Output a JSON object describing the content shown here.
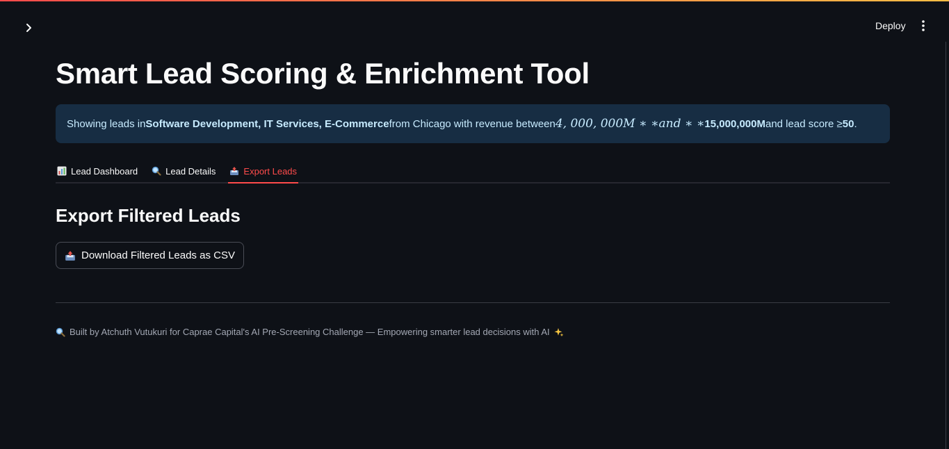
{
  "header": {
    "deploy_label": "Deploy",
    "sidebar_toggle_icon": "chevron-right-icon",
    "menu_icon": "kebab-menu-icon"
  },
  "main": {
    "title": "Smart Lead Scoring & Enrichment Tool",
    "info": {
      "prefix": "Showing leads in ",
      "industries": "Software Development, IT Services, E-Commerce",
      "from_text": " from Chicago with revenue between ",
      "math_text": "4, 000, 000M ∗ ∗and ∗ ∗",
      "max_revenue": "15,000,000M",
      "score_text": " and lead score ≥ ",
      "score_value": "50",
      "suffix": "."
    },
    "tabs": [
      {
        "label": "Lead Dashboard",
        "icon": "bar-chart-icon",
        "active": false
      },
      {
        "label": "Lead Details",
        "icon": "magnifier-icon",
        "active": false
      },
      {
        "label": "Export Leads",
        "icon": "outbox-tray-icon",
        "active": true
      }
    ],
    "section_title": "Export Filtered Leads",
    "download_button_label": "Download Filtered Leads as CSV",
    "footer_text": "Built by Atchuth Vutukuri for Caprae Capital's AI Pre-Screening Challenge — Empowering smarter lead decisions with AI"
  },
  "colors": {
    "background": "#0e1117",
    "accent": "#ff4b4b",
    "info_bg": "#172d43",
    "info_text": "#c7ebff"
  }
}
